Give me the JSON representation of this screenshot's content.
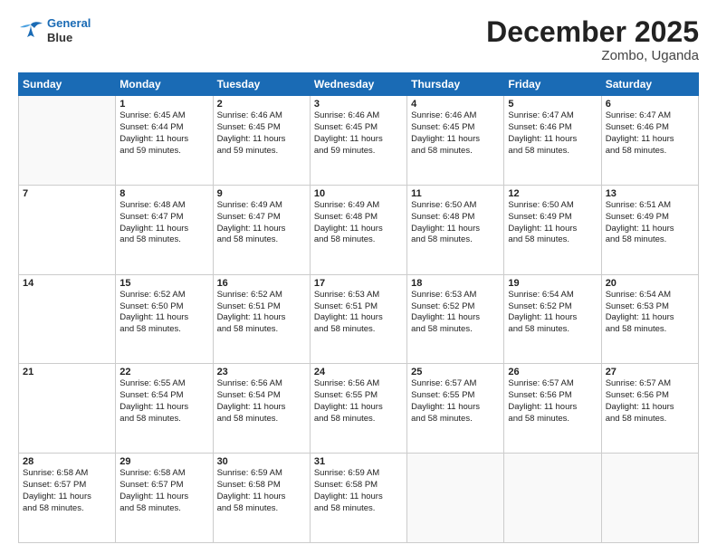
{
  "header": {
    "logo_line1": "General",
    "logo_line2": "Blue",
    "main_title": "December 2025",
    "subtitle": "Zombo, Uganda"
  },
  "calendar": {
    "days_of_week": [
      "Sunday",
      "Monday",
      "Tuesday",
      "Wednesday",
      "Thursday",
      "Friday",
      "Saturday"
    ],
    "weeks": [
      [
        {
          "day": "",
          "info": ""
        },
        {
          "day": "1",
          "info": "Sunrise: 6:45 AM\nSunset: 6:44 PM\nDaylight: 11 hours\nand 59 minutes."
        },
        {
          "day": "2",
          "info": "Sunrise: 6:46 AM\nSunset: 6:45 PM\nDaylight: 11 hours\nand 59 minutes."
        },
        {
          "day": "3",
          "info": "Sunrise: 6:46 AM\nSunset: 6:45 PM\nDaylight: 11 hours\nand 59 minutes."
        },
        {
          "day": "4",
          "info": "Sunrise: 6:46 AM\nSunset: 6:45 PM\nDaylight: 11 hours\nand 58 minutes."
        },
        {
          "day": "5",
          "info": "Sunrise: 6:47 AM\nSunset: 6:46 PM\nDaylight: 11 hours\nand 58 minutes."
        },
        {
          "day": "6",
          "info": "Sunrise: 6:47 AM\nSunset: 6:46 PM\nDaylight: 11 hours\nand 58 minutes."
        }
      ],
      [
        {
          "day": "7",
          "info": ""
        },
        {
          "day": "8",
          "info": "Sunrise: 6:48 AM\nSunset: 6:47 PM\nDaylight: 11 hours\nand 58 minutes."
        },
        {
          "day": "9",
          "info": "Sunrise: 6:49 AM\nSunset: 6:47 PM\nDaylight: 11 hours\nand 58 minutes."
        },
        {
          "day": "10",
          "info": "Sunrise: 6:49 AM\nSunset: 6:48 PM\nDaylight: 11 hours\nand 58 minutes."
        },
        {
          "day": "11",
          "info": "Sunrise: 6:50 AM\nSunset: 6:48 PM\nDaylight: 11 hours\nand 58 minutes."
        },
        {
          "day": "12",
          "info": "Sunrise: 6:50 AM\nSunset: 6:49 PM\nDaylight: 11 hours\nand 58 minutes."
        },
        {
          "day": "13",
          "info": "Sunrise: 6:51 AM\nSunset: 6:49 PM\nDaylight: 11 hours\nand 58 minutes."
        }
      ],
      [
        {
          "day": "14",
          "info": ""
        },
        {
          "day": "15",
          "info": "Sunrise: 6:52 AM\nSunset: 6:50 PM\nDaylight: 11 hours\nand 58 minutes."
        },
        {
          "day": "16",
          "info": "Sunrise: 6:52 AM\nSunset: 6:51 PM\nDaylight: 11 hours\nand 58 minutes."
        },
        {
          "day": "17",
          "info": "Sunrise: 6:53 AM\nSunset: 6:51 PM\nDaylight: 11 hours\nand 58 minutes."
        },
        {
          "day": "18",
          "info": "Sunrise: 6:53 AM\nSunset: 6:52 PM\nDaylight: 11 hours\nand 58 minutes."
        },
        {
          "day": "19",
          "info": "Sunrise: 6:54 AM\nSunset: 6:52 PM\nDaylight: 11 hours\nand 58 minutes."
        },
        {
          "day": "20",
          "info": "Sunrise: 6:54 AM\nSunset: 6:53 PM\nDaylight: 11 hours\nand 58 minutes."
        }
      ],
      [
        {
          "day": "21",
          "info": ""
        },
        {
          "day": "22",
          "info": "Sunrise: 6:55 AM\nSunset: 6:54 PM\nDaylight: 11 hours\nand 58 minutes."
        },
        {
          "day": "23",
          "info": "Sunrise: 6:56 AM\nSunset: 6:54 PM\nDaylight: 11 hours\nand 58 minutes."
        },
        {
          "day": "24",
          "info": "Sunrise: 6:56 AM\nSunset: 6:55 PM\nDaylight: 11 hours\nand 58 minutes."
        },
        {
          "day": "25",
          "info": "Sunrise: 6:57 AM\nSunset: 6:55 PM\nDaylight: 11 hours\nand 58 minutes."
        },
        {
          "day": "26",
          "info": "Sunrise: 6:57 AM\nSunset: 6:56 PM\nDaylight: 11 hours\nand 58 minutes."
        },
        {
          "day": "27",
          "info": "Sunrise: 6:57 AM\nSunset: 6:56 PM\nDaylight: 11 hours\nand 58 minutes."
        }
      ],
      [
        {
          "day": "28",
          "info": "Sunrise: 6:58 AM\nSunset: 6:57 PM\nDaylight: 11 hours\nand 58 minutes."
        },
        {
          "day": "29",
          "info": "Sunrise: 6:58 AM\nSunset: 6:57 PM\nDaylight: 11 hours\nand 58 minutes."
        },
        {
          "day": "30",
          "info": "Sunrise: 6:59 AM\nSunset: 6:58 PM\nDaylight: 11 hours\nand 58 minutes."
        },
        {
          "day": "31",
          "info": "Sunrise: 6:59 AM\nSunset: 6:58 PM\nDaylight: 11 hours\nand 58 minutes."
        },
        {
          "day": "",
          "info": ""
        },
        {
          "day": "",
          "info": ""
        },
        {
          "day": "",
          "info": ""
        }
      ]
    ]
  }
}
